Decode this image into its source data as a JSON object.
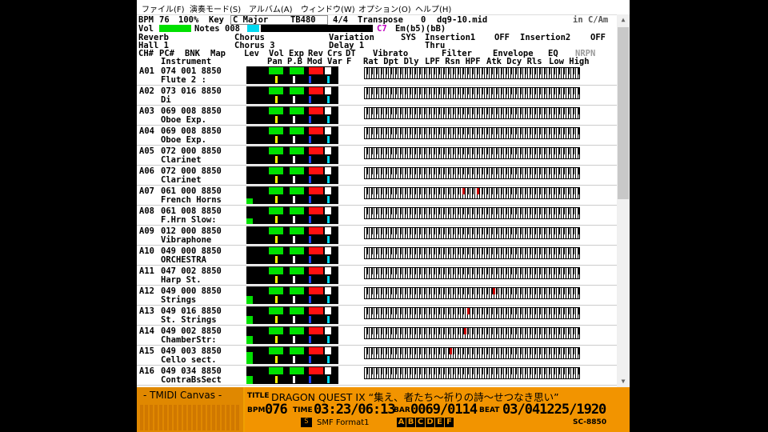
{
  "menu": [
    "ファイル(F)",
    "演奏モード(S)",
    "アルバム(A)",
    "ウィンドウ(W)",
    "オプション(O)",
    "ヘルプ(H)"
  ],
  "header": {
    "bpm_label": "BPM",
    "bpm": "76",
    "percent": "100%",
    "key_label": "Key",
    "key": "C Major",
    "tb": "TB480",
    "time_sig": "4/4",
    "transpose_label": "Transpose",
    "transpose": "0",
    "file": "dq9-10.mid",
    "in_key": "in C/Am",
    "vol_label": "Vol",
    "notes_label": "Notes",
    "notes": "008",
    "chord_root": "C7",
    "chord": "Em(b5)(bB)",
    "reverb_label": "Reverb",
    "reverb": "Hall 1",
    "chorus_label": "Chorus",
    "chorus": "Chorus 3",
    "variation_label": "Variation",
    "variation": "Delay 1",
    "sys": "SYS",
    "insertion1_label": "Insertion1",
    "insertion1": "OFF",
    "thru": "Thru",
    "insertion2_label": "Insertion2",
    "insertion2": "OFF",
    "col1": "CH#",
    "col2": "PC#",
    "col3": "BNK",
    "col4": "Map",
    "col5": "Instrument",
    "col_lev": "Lev",
    "col_vol": "Vol",
    "col_exp": "Exp",
    "col_rev": "Rev",
    "col_crs": "Crs",
    "col_dt": "DT",
    "col_pan": "Pan",
    "col_pb": "P.B",
    "col_mod": "Mod",
    "col_var": "Var",
    "col_f": "F",
    "vibrato": "Vibrato",
    "vib_sub": "Rat Dpt Dly",
    "filter": "Filter",
    "filter_sub": "LPF Rsn HPF",
    "envelope": "Envelope",
    "env_sub": "Atk Dcy Rls",
    "eq": "EQ",
    "eq_sub": "Low High",
    "nrpn": "NRPN"
  },
  "channels": [
    {
      "ch": "A01",
      "pc": "074",
      "bnk": "001",
      "map": "8850",
      "inst": "Flute 2    :",
      "lev": 0,
      "notes": []
    },
    {
      "ch": "A02",
      "pc": "073",
      "bnk": "016",
      "map": "8850",
      "inst": "Di",
      "lev": 0,
      "notes": []
    },
    {
      "ch": "A03",
      "pc": "069",
      "bnk": "008",
      "map": "8850",
      "inst": "Oboe Exp.",
      "lev": 0,
      "notes": []
    },
    {
      "ch": "A04",
      "pc": "069",
      "bnk": "008",
      "map": "8850",
      "inst": "Oboe Exp.",
      "lev": 0,
      "notes": []
    },
    {
      "ch": "A05",
      "pc": "072",
      "bnk": "000",
      "map": "8850",
      "inst": "Clarinet",
      "lev": 0,
      "notes": []
    },
    {
      "ch": "A06",
      "pc": "072",
      "bnk": "000",
      "map": "8850",
      "inst": "Clarinet",
      "lev": 0,
      "notes": []
    },
    {
      "ch": "A07",
      "pc": "061",
      "bnk": "000",
      "map": "8850",
      "inst": "French Horns",
      "lev": 0.3,
      "notes": [
        123,
        141
      ]
    },
    {
      "ch": "A08",
      "pc": "061",
      "bnk": "008",
      "map": "8850",
      "inst": "F.Hrn Slow:",
      "lev": 0.3,
      "notes": []
    },
    {
      "ch": "A09",
      "pc": "012",
      "bnk": "000",
      "map": "8850",
      "inst": "Vibraphone",
      "lev": 0,
      "notes": []
    },
    {
      "ch": "A10",
      "pc": "049",
      "bnk": "000",
      "map": "8850",
      "inst": "ORCHESTRA",
      "lev": 0,
      "notes": []
    },
    {
      "ch": "A11",
      "pc": "047",
      "bnk": "002",
      "map": "8850",
      "inst": "Harp St.",
      "lev": 0,
      "notes": []
    },
    {
      "ch": "A12",
      "pc": "049",
      "bnk": "000",
      "map": "8850",
      "inst": "Strings",
      "lev": 0.45,
      "notes": [
        161
      ]
    },
    {
      "ch": "A13",
      "pc": "049",
      "bnk": "016",
      "map": "8850",
      "inst": "St. Strings",
      "lev": 0.45,
      "notes": [
        129
      ]
    },
    {
      "ch": "A14",
      "pc": "049",
      "bnk": "002",
      "map": "8850",
      "inst": "ChamberStr:",
      "lev": 0.45,
      "notes": [
        125
      ]
    },
    {
      "ch": "A15",
      "pc": "049",
      "bnk": "003",
      "map": "8850",
      "inst": "Cello sect.",
      "lev": 0.7,
      "notes": [
        107
      ]
    },
    {
      "ch": "A16",
      "pc": "049",
      "bnk": "034",
      "map": "8850",
      "inst": "ContraBsSect",
      "lev": 0.45,
      "notes": []
    }
  ],
  "canvas": {
    "label": "- TMIDI Canvas -"
  },
  "info": {
    "title_label": "TITLE",
    "title": "DRAGON QUEST IX “集え、者たち〜祈りの詩〜せつなき思い”",
    "bpm_label": "BPM",
    "bpm": "076",
    "time_label": "TIME",
    "time": "03:23/06:13",
    "bar_label": "BAR",
    "bar": "0069/0114",
    "beat_label": "BEAT",
    "beat": "03/041225/1920",
    "format": "SMF Format1",
    "ports": [
      "A",
      "B",
      "C",
      "D",
      "E",
      "F"
    ],
    "module": "SC-8850"
  }
}
